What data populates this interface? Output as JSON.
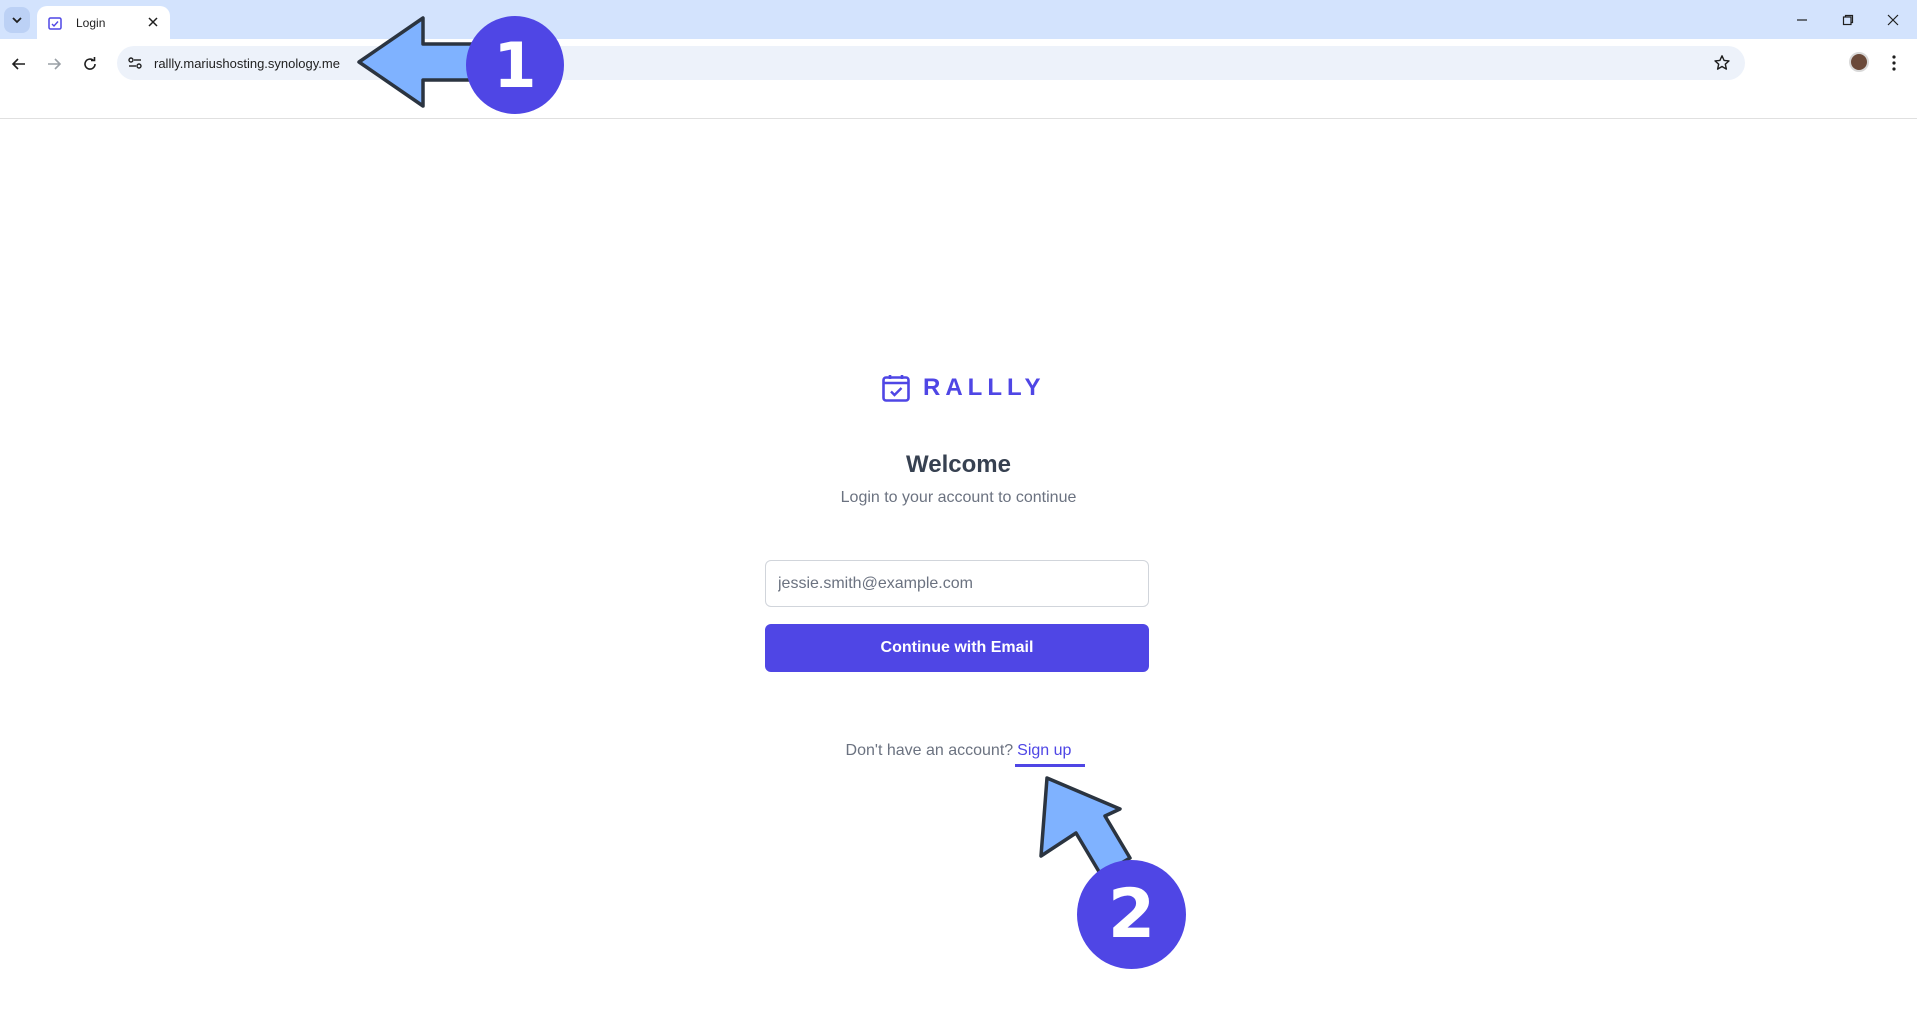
{
  "browser": {
    "tab_title": "Login",
    "url": "rallly.mariushosting.synology.me"
  },
  "page": {
    "logo_text": "RALLLY",
    "heading": "Welcome",
    "subtitle": "Login to your account to continue",
    "email_placeholder": "jessie.smith@example.com",
    "continue_label": "Continue with Email",
    "signup_prompt": "Don't have an account?",
    "signup_link": "Sign up"
  },
  "annotations": {
    "step1": "1",
    "step2": "2"
  },
  "colors": {
    "brand": "#4f46e5",
    "arrow_fill": "#7fb2ff",
    "arrow_stroke": "#2b3440",
    "tabstrip": "#d3e3fd"
  },
  "icons": [
    "tab-search-icon",
    "calendar-check-icon",
    "close-icon",
    "minimize-icon",
    "restore-icon",
    "back-icon",
    "forward-icon",
    "reload-icon",
    "site-info-icon",
    "star-icon",
    "kebab-menu-icon"
  ]
}
